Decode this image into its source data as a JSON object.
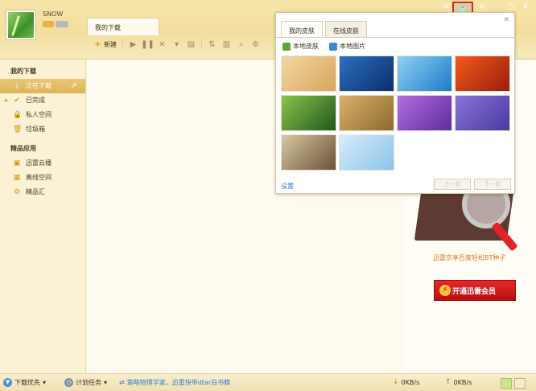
{
  "user": {
    "name": "SNOW"
  },
  "main_tab": {
    "label": "我的下载"
  },
  "toolbar": {
    "new_label": "新建"
  },
  "sidebar": {
    "groups": [
      {
        "title": "我的下载"
      },
      {
        "title": "精品应用"
      }
    ],
    "items": [
      {
        "label": "正在下载",
        "icon": "download-icon"
      },
      {
        "label": "已完成",
        "icon": "check-icon"
      },
      {
        "label": "私人空间",
        "icon": "lock-icon"
      },
      {
        "label": "垃圾箱",
        "icon": "trash-icon"
      },
      {
        "label": "迅雷云播",
        "icon": "cloud-play-icon"
      },
      {
        "label": "离线空间",
        "icon": "offline-space-icon"
      },
      {
        "label": "精品汇",
        "icon": "gear-icon"
      }
    ]
  },
  "ad": {
    "caption": "迅雷京享百度轻松BT种子",
    "button_label": "开通迅雷会员"
  },
  "skin_popup": {
    "tabs": [
      {
        "label": "我的皮肤"
      },
      {
        "label": "在线皮肤"
      }
    ],
    "local_skin_label": "本地皮肤",
    "local_image_label": "本地图片",
    "settings_label": "设置",
    "prev_label": "上一页",
    "next_label": "下一页",
    "thumbnails": [
      {
        "name": "skin-thumb-feather",
        "colors": [
          "#f2d7a3",
          "#d9a65b"
        ]
      },
      {
        "name": "skin-thumb-blue-water",
        "colors": [
          "#2c6fc0",
          "#0b2f6d"
        ]
      },
      {
        "name": "skin-thumb-blue-flower",
        "colors": [
          "#8fd2f2",
          "#1c7cc8"
        ]
      },
      {
        "name": "skin-thumb-red-flower",
        "colors": [
          "#f25a1c",
          "#9c1e0c"
        ]
      },
      {
        "name": "skin-thumb-green-grass",
        "colors": [
          "#8cc24a",
          "#1f5a1c"
        ]
      },
      {
        "name": "skin-thumb-wheat",
        "colors": [
          "#d9b06a",
          "#8c6a2c"
        ]
      },
      {
        "name": "skin-thumb-purple-drops",
        "colors": [
          "#b46ee0",
          "#5c2c9c"
        ]
      },
      {
        "name": "skin-thumb-purple-flowers",
        "colors": [
          "#8a72d8",
          "#4a3aa0"
        ]
      },
      {
        "name": "skin-thumb-bamboo",
        "colors": [
          "#d8c8a4",
          "#6a5236"
        ]
      },
      {
        "name": "skin-thumb-sky",
        "colors": [
          "#d8ecf8",
          "#8cc4e8"
        ]
      }
    ]
  },
  "statusbar": {
    "priority_label": "下载优先",
    "schedule_label": "计划任务",
    "notice": "策略物理学家，迅雷快带dtar白书籍",
    "download_speed": "0KB/s",
    "upload_speed": "0KB/s"
  },
  "colors": {
    "sidebar_active": "#dcb45a",
    "ad_button": "#d01c1e",
    "highlight_box": "#e3202a"
  }
}
